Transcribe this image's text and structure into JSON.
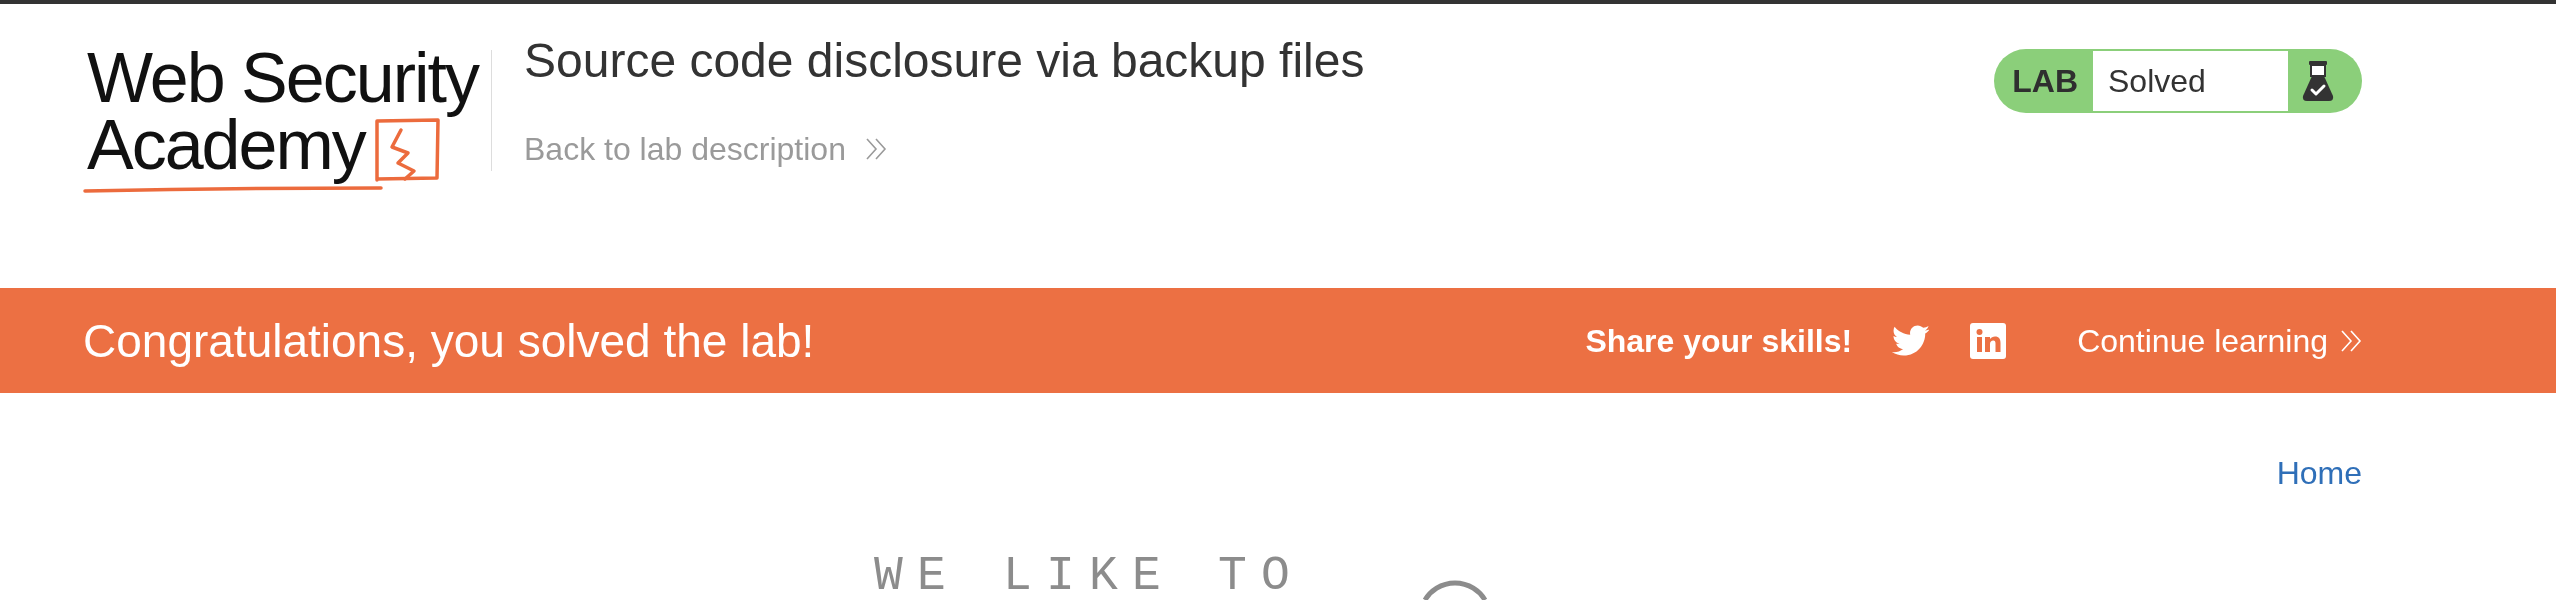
{
  "header": {
    "logo": {
      "lines": [
        "Web Security",
        "Academy"
      ]
    },
    "title": "Source code disclosure via backup files",
    "back_link": "Back to lab description",
    "status": {
      "label": "LAB",
      "value": "Solved",
      "solved": true
    }
  },
  "banner": {
    "message": "Congratulations, you solved the lab!",
    "share_label": "Share your skills!",
    "share_links": [
      {
        "kind": "twitter"
      },
      {
        "kind": "linkedin"
      }
    ],
    "continue_link": "Continue learning"
  },
  "nav": {
    "links": [
      {
        "label": "Home"
      }
    ]
  },
  "hero": {
    "heading": "WE LIKE TO"
  }
}
